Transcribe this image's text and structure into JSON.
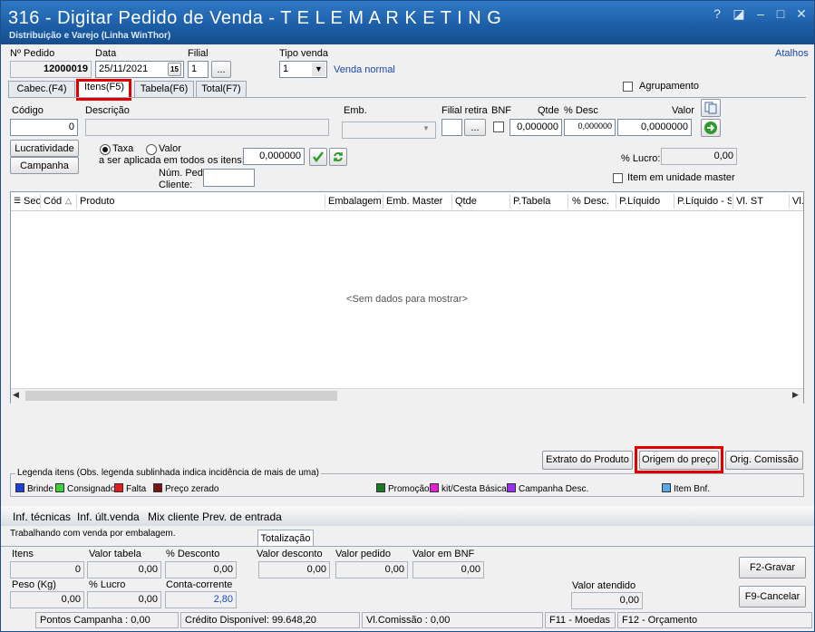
{
  "window": {
    "title": "316 - Digitar Pedido de Venda - T E L E M A R K E T I N G",
    "subtitle": "Distribuição e Varejo (Linha WinThor)",
    "controls": [
      "?",
      "◪",
      "–",
      "□",
      "✕"
    ]
  },
  "header": {
    "pedido_label": "Nº Pedido",
    "pedido_value": "12000019",
    "data_label": "Data",
    "data_value": "25/11/2021",
    "calendar_icon": "15",
    "filial_label": "Filial",
    "filial_value": "1",
    "filial_button": "...",
    "tipo_venda_label": "Tipo venda",
    "tipo_venda_value": "1",
    "tipo_venda_desc": "Venda normal",
    "atalhos": "Atalhos"
  },
  "tabs": [
    "Cabec.(F4)",
    "Itens(F5)",
    "Tabela(F6)",
    "Total(F7)"
  ],
  "agrupamento_label": "Agrupamento",
  "item_entry": {
    "codigo_label": "Código",
    "codigo_value": "0",
    "descricao_label": "Descrição",
    "emb_label": "Emb.",
    "filial_retira_label": "Filial retira",
    "filial_retira_button": "...",
    "bnf_label": "BNF",
    "qtde_label": "Qtde",
    "qtde_value": "0,000000",
    "desc_label": "% Desc",
    "desc_value": "0,000000",
    "valor_label": "Valor",
    "valor_value": "0,0000000"
  },
  "actions": {
    "lucratividade": "Lucratividade",
    "campanha": "Campanha",
    "taxa_label": "Taxa",
    "valor_label": "Valor",
    "aplicada_label": "a ser aplicada em todos os itens:",
    "aplicada_value": "0,000000",
    "num_ped_label": "Núm. Ped.",
    "cliente_label": "Cliente:",
    "lucro_label": "% Lucro:",
    "lucro_value": "0,00",
    "item_master_label": "Item em unidade master"
  },
  "grid": {
    "columns": [
      "Sec",
      "Cód",
      "Produto",
      "Embalagem",
      "Emb. Master",
      "Qtde",
      "P.Tabela",
      "% Desc.",
      "P.Líquido",
      "P.Líquido - S",
      "Vl. ST",
      "Vl."
    ],
    "empty_text": "<Sem dados para mostrar>"
  },
  "buttons": {
    "extrato": "Extrato do Produto",
    "origem": "Origem do preço",
    "comissao": "Orig. Comissão"
  },
  "legend": {
    "title": "Legenda itens (Obs. legenda sublinhada indica incidência de mais de uma)",
    "items": [
      {
        "label": "Brinde",
        "color": "#1f3fd6"
      },
      {
        "label": "Consignado",
        "color": "#3ad13a"
      },
      {
        "label": "Falta",
        "color": "#e61c1c"
      },
      {
        "label": "Preço zerado",
        "color": "#7a1414"
      },
      {
        "label": "Promoção",
        "color": "#1b7a2a"
      },
      {
        "label": "kit/Cesta Básica",
        "color": "#e21fd8"
      },
      {
        "label": "Campanha Desc.",
        "color": "#9b2ff0"
      },
      {
        "label": "Item Bnf.",
        "color": "#5aa9e6"
      }
    ]
  },
  "info_tabs": [
    "Inf. técnicas",
    "Inf. últ.venda",
    "Mix cliente",
    "Prev. de entrada"
  ],
  "info_text": "Trabalhando com venda por embalagem.",
  "totals": {
    "tab_label": "Totalização",
    "itens_label": "Itens",
    "itens_value": "0",
    "valor_tabela_label": "Valor tabela",
    "valor_tabela_value": "0,00",
    "pct_desconto_label": "% Desconto",
    "pct_desconto_value": "0,00",
    "valor_desconto_label": "Valor desconto",
    "valor_desconto_value": "0,00",
    "valor_pedido_label": "Valor pedido",
    "valor_pedido_value": "0,00",
    "valor_bnf_label": "Valor em BNF",
    "valor_bnf_value": "0,00",
    "peso_label": "Peso (Kg)",
    "peso_value": "0,00",
    "pct_lucro_label": "% Lucro",
    "pct_lucro_value": "0,00",
    "conta_corrente_label": "Conta-corrente",
    "conta_corrente_value": "2,80",
    "valor_atendido_label": "Valor atendido",
    "valor_atendido_value": "0,00",
    "gravar": "F2-Gravar",
    "cancelar": "F9-Cancelar"
  },
  "statusbar": {
    "pontos": "Pontos Campanha : 0,00",
    "credito": "Crédito Disponível: 99.648,20",
    "comissao": "Vl.Comissão : 0,00",
    "moedas": "F11 - Moedas",
    "orcamento": "F12 - Orçamento"
  }
}
